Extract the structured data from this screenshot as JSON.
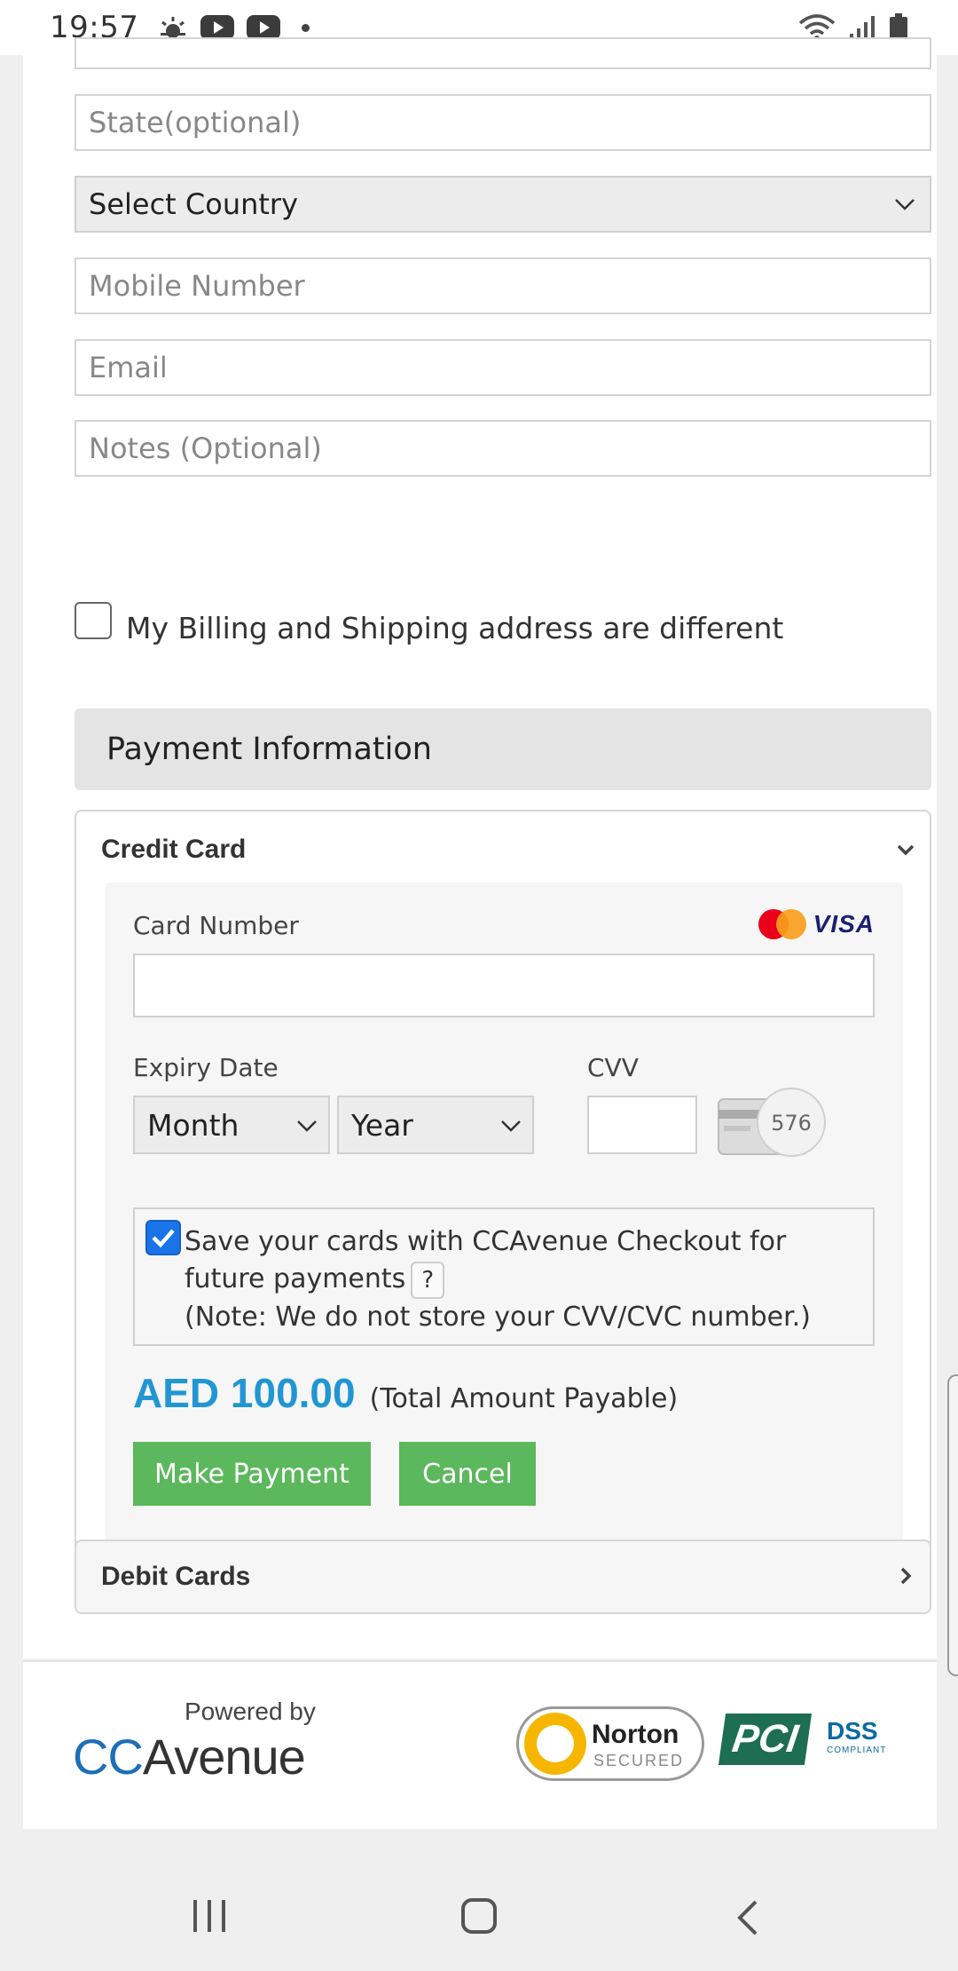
{
  "status_bar": {
    "time": "19:57"
  },
  "form": {
    "state_placeholder": "State(optional)",
    "country_selected": "Select Country",
    "mobile_placeholder": "Mobile Number",
    "email_placeholder": "Email",
    "notes_placeholder": "Notes (Optional)",
    "billing_shipping_label": "My Billing and Shipping address are different"
  },
  "payment": {
    "section_title": "Payment Information",
    "credit_card": {
      "title": "Credit Card",
      "card_number_label": "Card Number",
      "card_logos": [
        "mastercard-logo",
        "visa-logo"
      ],
      "visa_text": "VISA",
      "expiry_label": "Expiry Date",
      "month_selected": "Month",
      "year_selected": "Year",
      "cvv_label": "CVV",
      "cvv_hint_digits": "576",
      "save_card_line1": "Save your cards with CCAvenue Checkout for",
      "save_card_line2": "future payments",
      "save_card_help": "?",
      "save_card_note": "(Note: We do not store your CVV/CVC number.)",
      "save_card_checked": true,
      "amount": "AED 100.00",
      "amount_label": "(Total Amount Payable)",
      "make_payment_label": "Make Payment",
      "cancel_label": "Cancel"
    },
    "debit_cards_title": "Debit Cards"
  },
  "footer": {
    "powered_by": "Powered by",
    "brand_cc": "CC",
    "brand_avenue": "Avenue",
    "norton_text": "Norton",
    "norton_sub": "SECURED",
    "pci_text": "PCI",
    "dss_text": "DSS",
    "dss_sub": "COMPLIANT"
  },
  "colors": {
    "accent_blue": "#2196d3",
    "button_green": "#5cb85c",
    "checkbox_blue": "#1a73e8"
  }
}
